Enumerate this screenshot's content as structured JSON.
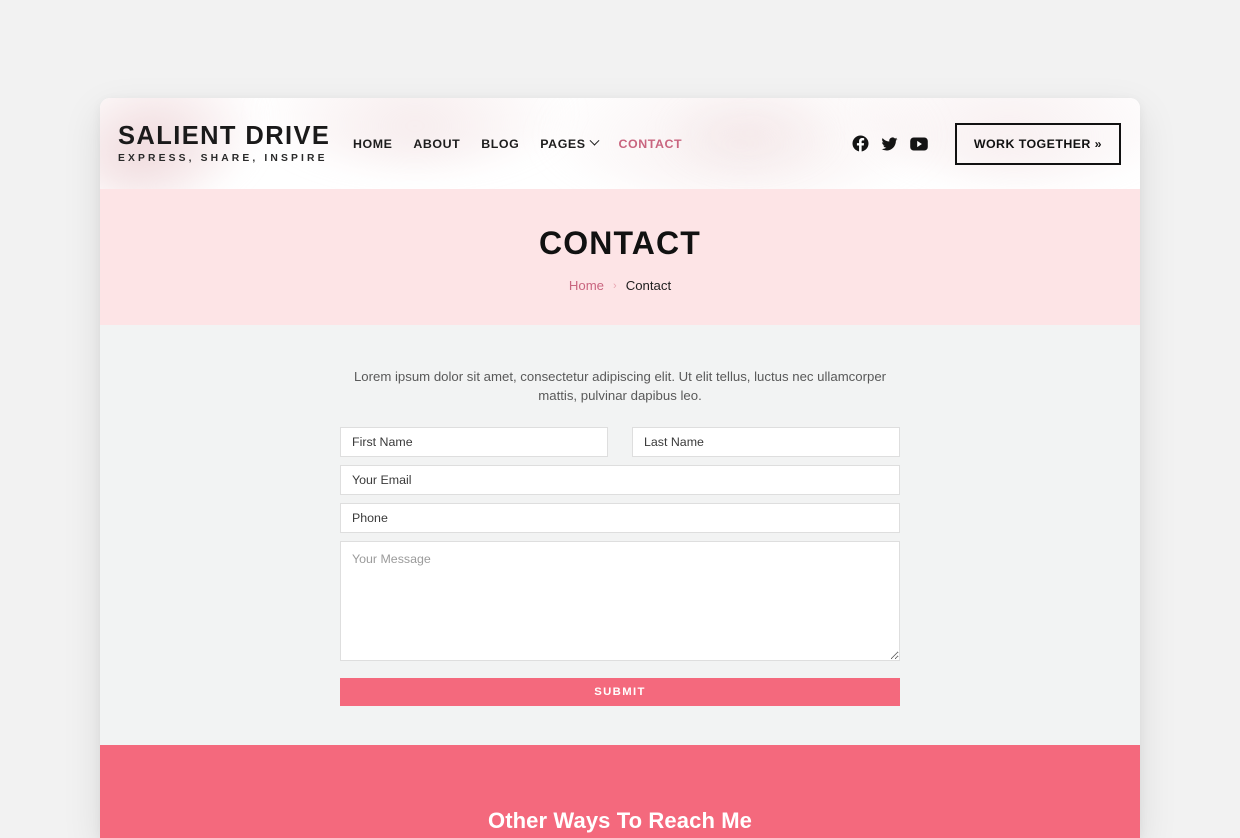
{
  "brand": {
    "name": "SALIENT DRIVE",
    "tagline": "EXPRESS, SHARE, INSPIRE"
  },
  "nav": {
    "items": [
      {
        "label": "HOME",
        "active": false,
        "dropdown": false
      },
      {
        "label": "ABOUT",
        "active": false,
        "dropdown": false
      },
      {
        "label": "BLOG",
        "active": false,
        "dropdown": false
      },
      {
        "label": "PAGES",
        "active": false,
        "dropdown": true
      },
      {
        "label": "CONTACT",
        "active": true,
        "dropdown": false
      }
    ]
  },
  "header": {
    "social": [
      {
        "name": "facebook-icon"
      },
      {
        "name": "twitter-icon"
      },
      {
        "name": "youtube-icon"
      }
    ],
    "cta_label": "WORK TOGETHER »"
  },
  "hero": {
    "title": "CONTACT",
    "breadcrumb": {
      "home": "Home",
      "separator": "›",
      "current": "Contact"
    }
  },
  "contact": {
    "intro": "Lorem ipsum dolor sit amet, consectetur adipiscing elit. Ut elit tellus, luctus nec ullamcorper mattis, pulvinar dapibus leo.",
    "fields": {
      "first_name": {
        "placeholder": "First Name",
        "value": ""
      },
      "last_name": {
        "placeholder": "Last Name",
        "value": ""
      },
      "email": {
        "placeholder": "Your Email",
        "value": ""
      },
      "phone": {
        "placeholder": "Phone",
        "value": ""
      },
      "message": {
        "placeholder": "Your Message",
        "value": ""
      }
    },
    "submit_label": "SUBMIT"
  },
  "reach": {
    "heading": "Other Ways To Reach Me"
  },
  "colors": {
    "accent_pink": "#f4697d",
    "hero_pink": "#fde4e6",
    "link_rose": "#c9657f",
    "page_background": "#f2f2f2",
    "section_background": "#f2f3f3",
    "text_dark": "#111111"
  }
}
